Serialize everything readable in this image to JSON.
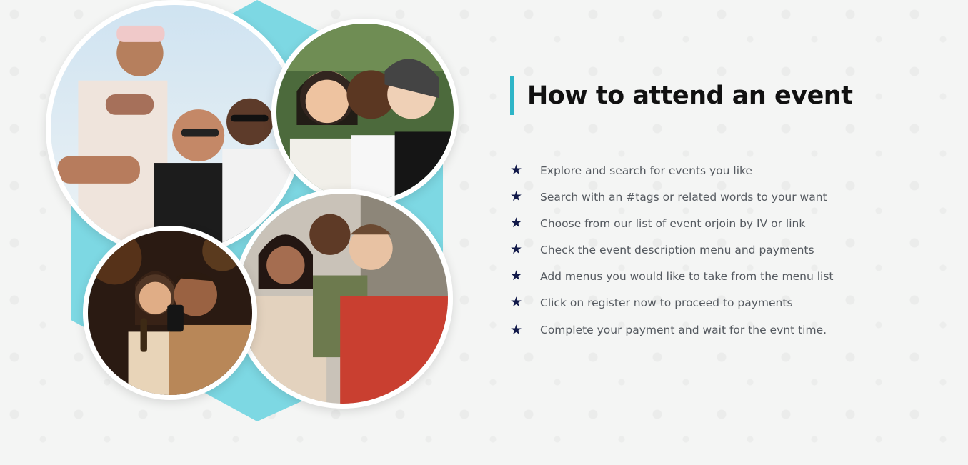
{
  "section": {
    "title": "How to attend an event",
    "accent_color": "#2eb5c7",
    "hexagon_color": "#7dd8e3",
    "bullet_icon": "star-icon",
    "bullet_color": "#121a4a"
  },
  "steps": [
    {
      "text": "Explore and search for events you like"
    },
    {
      "text": "Search with an #tags or related words to your want"
    },
    {
      "text": "Choose from our list of event orjoin by IV or link"
    },
    {
      "text": "Check the event description menu and payments"
    },
    {
      "text": "Add menus you would like to take from the menu list"
    },
    {
      "text": "Click on register now to proceed to payments"
    },
    {
      "text": "Complete your payment and wait for the evnt time."
    }
  ]
}
